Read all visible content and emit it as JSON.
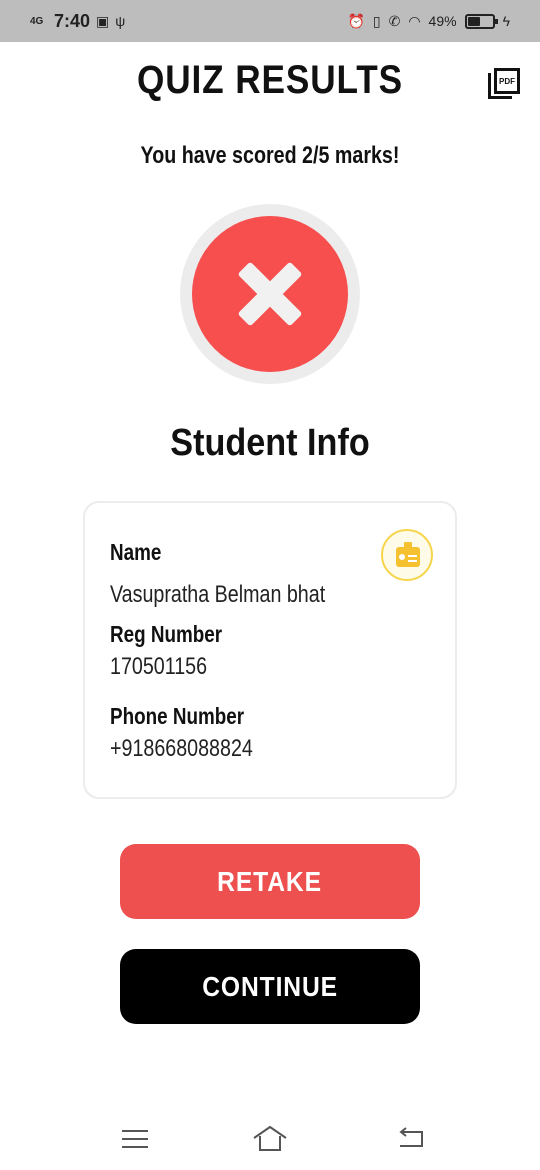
{
  "status_bar": {
    "network": "4G",
    "time": "7:40",
    "battery": "49%",
    "battery_level": 0.49
  },
  "header": {
    "title": "QUIZ RESULTS",
    "pdf_label": "PDF"
  },
  "score": {
    "text": "You have scored 2/5 marks!",
    "passed": false
  },
  "student_info": {
    "title": "Student Info",
    "name_label": "Name",
    "name_value": "Vasupratha Belman bhat",
    "reg_label": "Reg Number",
    "reg_value": "170501156",
    "phone_label": "Phone Number",
    "phone_value": "+918668088824"
  },
  "actions": {
    "retake": "RETAKE",
    "continue": "CONTINUE"
  },
  "colors": {
    "fail_red": "#f74e4e",
    "retake_red": "#ee5050",
    "badge_yellow": "#f6c12e",
    "status_bar": "#bdbdbd"
  },
  "icons": {
    "pdf": "pdf-document-icon",
    "result": "close-x-icon",
    "badge": "id-card-icon"
  }
}
